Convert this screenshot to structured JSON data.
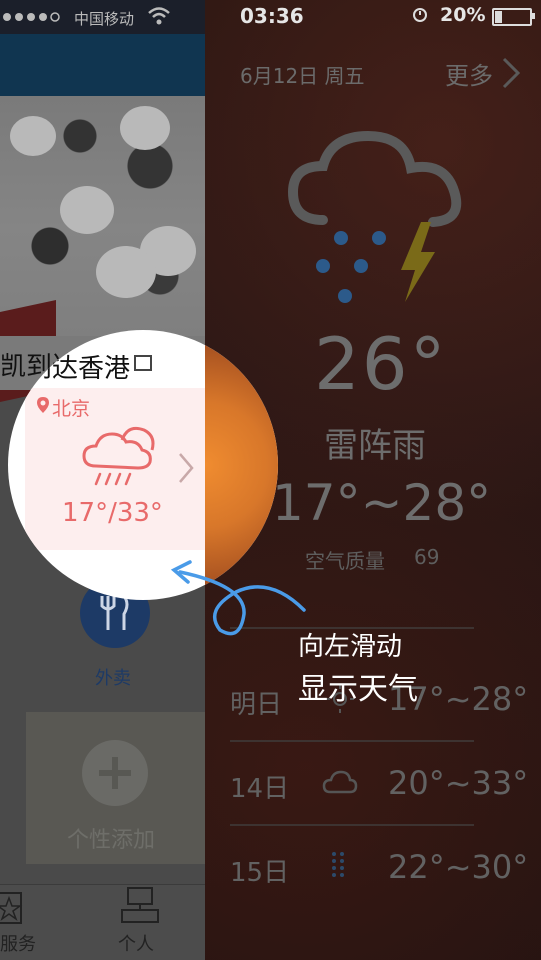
{
  "status_bar": {
    "carrier": "中国移动",
    "time": "03:36",
    "battery": "20%",
    "battery_level": 0.2
  },
  "left_pane": {
    "news_caption": "凯到达香港",
    "takeout_label": "外卖",
    "add_label": "个性添加",
    "tabs": [
      "服务",
      "个人"
    ],
    "weather_card": {
      "city": "北京",
      "temp_range": "17°/33°"
    }
  },
  "weather": {
    "date": "6月12日 周五",
    "more": "更多",
    "current_temp": "26°",
    "condition": "雷阵雨",
    "today_range": "17°~28°",
    "air_quality_label": "空气质量",
    "air_quality_value": "69",
    "forecast": [
      {
        "day": "明日",
        "icon": "sun-icon",
        "range": "17°~28°"
      },
      {
        "day": "14日",
        "icon": "cloud-icon",
        "range": "20°~33°"
      },
      {
        "day": "15日",
        "icon": "rain-icon",
        "range": "22°~30°"
      }
    ]
  },
  "hint": {
    "line1": "向左滑动",
    "line2": "显示天气"
  },
  "colors": {
    "card_red": "#e86a6a",
    "dark_text": "#6d6d6d",
    "arrow_blue": "#4a9be8",
    "takeout_blue": "#1d3a66"
  }
}
